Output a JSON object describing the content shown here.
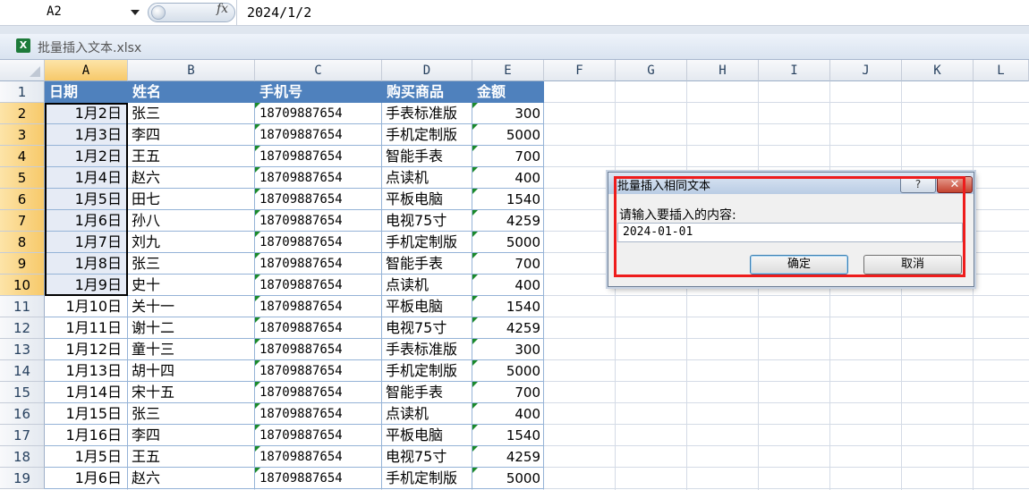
{
  "formula_bar": {
    "cell_ref": "A2",
    "fx_label": "fx",
    "value": "2024/1/2"
  },
  "workbook": {
    "title": "批量插入文本.xlsx"
  },
  "columns": [
    "A",
    "B",
    "C",
    "D",
    "E",
    "F",
    "G",
    "H",
    "I",
    "J",
    "K",
    "L"
  ],
  "header_row": [
    "日期",
    "姓名",
    "手机号",
    "购买商品",
    "金额"
  ],
  "rows": [
    {
      "n": "2",
      "date": "1月2日",
      "name": "张三",
      "phone": "18709887654",
      "product": "手表标准版",
      "amount": "300"
    },
    {
      "n": "3",
      "date": "1月3日",
      "name": "李四",
      "phone": "18709887654",
      "product": "手机定制版",
      "amount": "5000"
    },
    {
      "n": "4",
      "date": "1月2日",
      "name": "王五",
      "phone": "18709887654",
      "product": "智能手表",
      "amount": "700"
    },
    {
      "n": "5",
      "date": "1月4日",
      "name": "赵六",
      "phone": "18709887654",
      "product": "点读机",
      "amount": "400"
    },
    {
      "n": "6",
      "date": "1月5日",
      "name": "田七",
      "phone": "18709887654",
      "product": "平板电脑",
      "amount": "1540"
    },
    {
      "n": "7",
      "date": "1月6日",
      "name": "孙八",
      "phone": "18709887654",
      "product": "电视75寸",
      "amount": "4259"
    },
    {
      "n": "8",
      "date": "1月7日",
      "name": "刘九",
      "phone": "18709887654",
      "product": "手机定制版",
      "amount": "5000"
    },
    {
      "n": "9",
      "date": "1月8日",
      "name": "张三",
      "phone": "18709887654",
      "product": "智能手表",
      "amount": "700"
    },
    {
      "n": "10",
      "date": "1月9日",
      "name": "史十",
      "phone": "18709887654",
      "product": "点读机",
      "amount": "400"
    },
    {
      "n": "11",
      "date": "1月10日",
      "name": "关十一",
      "phone": "18709887654",
      "product": "平板电脑",
      "amount": "1540"
    },
    {
      "n": "12",
      "date": "1月11日",
      "name": "谢十二",
      "phone": "18709887654",
      "product": "电视75寸",
      "amount": "4259"
    },
    {
      "n": "13",
      "date": "1月12日",
      "name": "童十三",
      "phone": "18709887654",
      "product": "手表标准版",
      "amount": "300"
    },
    {
      "n": "14",
      "date": "1月13日",
      "name": "胡十四",
      "phone": "18709887654",
      "product": "手机定制版",
      "amount": "5000"
    },
    {
      "n": "15",
      "date": "1月14日",
      "name": "宋十五",
      "phone": "18709887654",
      "product": "智能手表",
      "amount": "700"
    },
    {
      "n": "16",
      "date": "1月15日",
      "name": "张三",
      "phone": "18709887654",
      "product": "点读机",
      "amount": "400"
    },
    {
      "n": "17",
      "date": "1月16日",
      "name": "李四",
      "phone": "18709887654",
      "product": "平板电脑",
      "amount": "1540"
    },
    {
      "n": "18",
      "date": "1月5日",
      "name": "王五",
      "phone": "18709887654",
      "product": "电视75寸",
      "amount": "4259"
    },
    {
      "n": "19",
      "date": "1月6日",
      "name": "赵六",
      "phone": "18709887654",
      "product": "手机定制版",
      "amount": "5000"
    }
  ],
  "dialog": {
    "title": "批量插入相同文本",
    "help": "?",
    "close": "✕",
    "prompt": "请输入要插入的内容:",
    "input_value": "2024-01-01",
    "ok": "确定",
    "cancel": "取消"
  }
}
